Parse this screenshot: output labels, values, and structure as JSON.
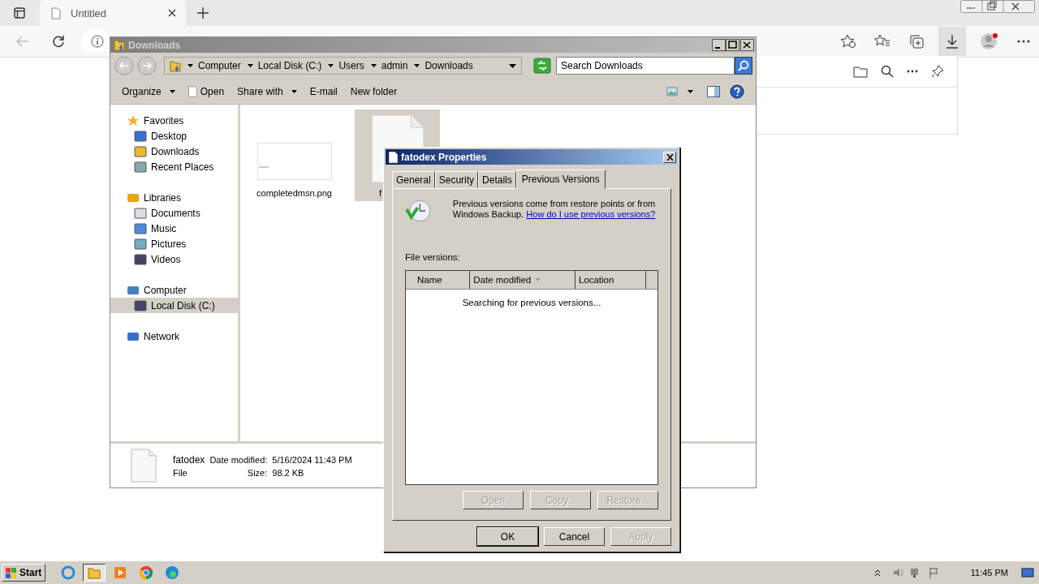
{
  "browser": {
    "tabs": [
      {
        "title": "Untitled",
        "selected": true
      }
    ]
  },
  "explorer": {
    "title": "Downloads",
    "breadcrumb": [
      "Computer",
      "Local Disk (C:)",
      "Users",
      "admin",
      "Downloads"
    ],
    "search": {
      "placeholder": "Search Downloads"
    },
    "toolbar": [
      {
        "label": "Organize",
        "dropdown": true
      },
      {
        "label": "Open",
        "dropdown": false
      },
      {
        "label": "Share with",
        "dropdown": true
      },
      {
        "label": "E-mail",
        "dropdown": false
      },
      {
        "label": "New folder",
        "dropdown": false
      }
    ],
    "nav": [
      {
        "label": "Favorites",
        "selected": false,
        "children": [
          {
            "label": "Desktop",
            "selected": false
          },
          {
            "label": "Downloads",
            "selected": false
          },
          {
            "label": "Recent Places",
            "selected": false
          }
        ]
      },
      {
        "label": "Libraries",
        "selected": false,
        "children": [
          {
            "label": "Documents",
            "selected": false
          },
          {
            "label": "Music",
            "selected": false
          },
          {
            "label": "Pictures",
            "selected": false
          },
          {
            "label": "Videos",
            "selected": false
          }
        ]
      },
      {
        "label": "Computer",
        "selected": false,
        "children": [
          {
            "label": "Local Disk (C:)",
            "selected": true
          }
        ]
      },
      {
        "label": "Network",
        "selected": false
      }
    ],
    "files": [
      {
        "name": "completedmsn.png",
        "kind": "image",
        "selected": false
      },
      {
        "name": "f",
        "kind": "file",
        "selected": true
      }
    ],
    "details": {
      "name": "fatodex",
      "type": "File",
      "date_label": "Date modified:",
      "date": "5/16/2024 11:43 PM",
      "size_label": "Size:",
      "size": "98.2 KB"
    }
  },
  "dialog": {
    "title": "fatodex Properties",
    "tabs": [
      {
        "label": "General",
        "selected": false
      },
      {
        "label": "Security",
        "selected": false
      },
      {
        "label": "Details",
        "selected": false
      },
      {
        "label": "Previous Versions",
        "selected": true
      }
    ],
    "intro": "Previous versions come from restore points or from Windows Backup.",
    "link": "How do I use previous versions?",
    "versions_label": "File versions:",
    "columns": [
      {
        "label": "Name",
        "sorted": false
      },
      {
        "label": "Date modified",
        "sorted": true
      },
      {
        "label": "Location",
        "sorted": false
      }
    ],
    "status": "Searching for previous versions...",
    "actions": [
      {
        "label": "Open",
        "disabled": true
      },
      {
        "label": "Copy...",
        "disabled": true
      },
      {
        "label": "Restore...",
        "disabled": true
      }
    ],
    "buttons": [
      {
        "label": "OK",
        "disabled": false
      },
      {
        "label": "Cancel",
        "disabled": false
      },
      {
        "label": "Apply",
        "disabled": true
      }
    ]
  },
  "taskbar": {
    "start": "Start",
    "apps": [
      {
        "selected": false
      },
      {
        "selected": true
      },
      {
        "selected": false
      },
      {
        "selected": false
      },
      {
        "selected": false
      }
    ],
    "time": "11:45 PM"
  }
}
